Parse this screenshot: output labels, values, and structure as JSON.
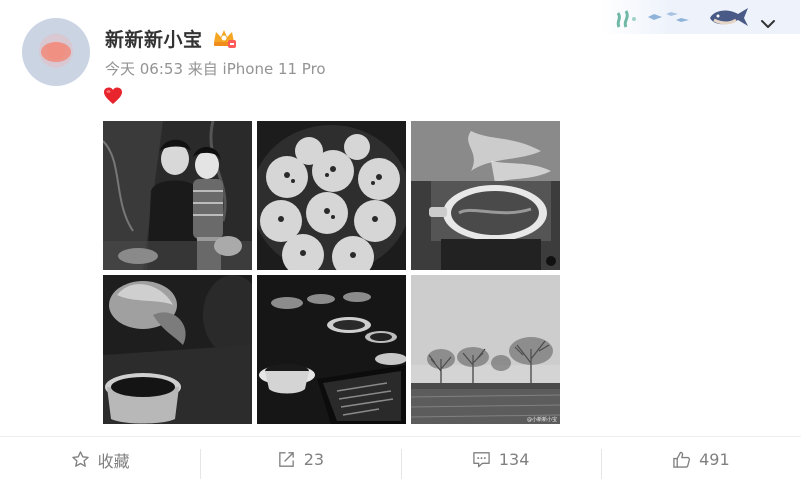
{
  "post": {
    "author_name": "新新新小宝",
    "time": "今天 06:53",
    "source": "来自 iPhone 11 Pro",
    "text_emoji": "heart",
    "photos": [
      {
        "icon": "photo-couple"
      },
      {
        "icon": "photo-buns"
      },
      {
        "icon": "photo-hotpot"
      },
      {
        "icon": "photo-tea-table"
      },
      {
        "icon": "photo-teacups-laptop"
      },
      {
        "icon": "photo-trees-field"
      }
    ],
    "photo_watermark": "@小新新小宝"
  },
  "actions": {
    "favorite_label": "收藏",
    "repost_count": "23",
    "comment_count": "134",
    "like_count": "491"
  },
  "colors": {
    "name": "#333333",
    "meta": "#939393",
    "action": "#808080",
    "heart": "#e8242c"
  }
}
